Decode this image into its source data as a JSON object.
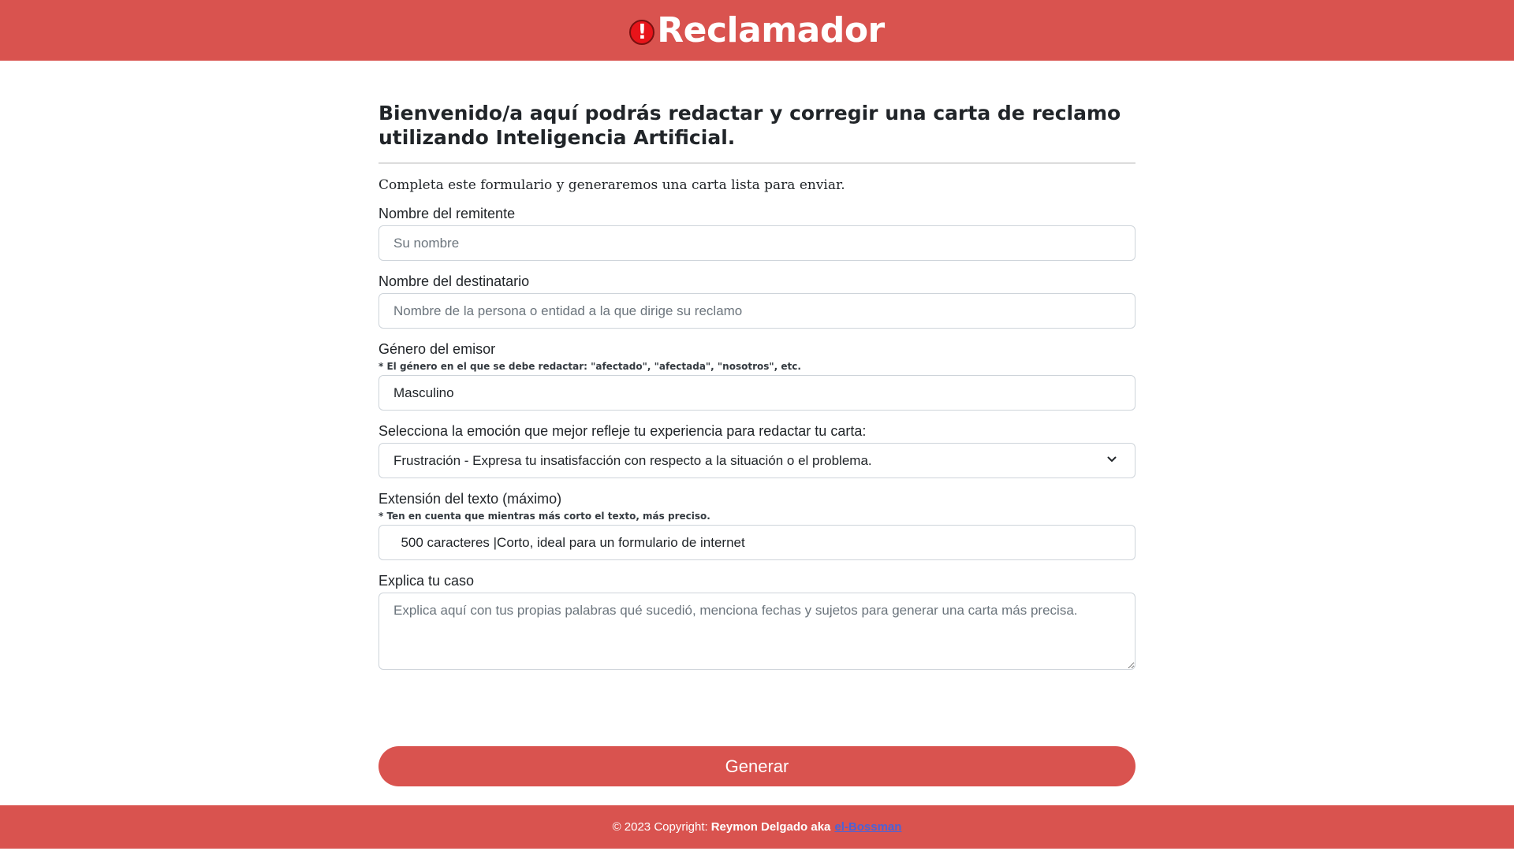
{
  "header": {
    "brand_icon": "!",
    "brand_name": "Reclamador"
  },
  "intro": {
    "title": "Bienvenido/a aquí podrás redactar y corregir una carta de reclamo utilizando Inteligencia Artificial.",
    "subtitle": "Completa este formulario y generaremos una carta lista para enviar."
  },
  "form": {
    "sender": {
      "label": "Nombre del remitente",
      "placeholder": "Su nombre"
    },
    "recipient": {
      "label": "Nombre del destinatario",
      "placeholder": "Nombre de la persona o entidad a la que dirige su reclamo"
    },
    "gender": {
      "label": "Género del emisor",
      "hint": "* El género en el que se debe redactar: \"afectado\", \"afectada\", \"nosotros\", etc.",
      "value": "Masculino"
    },
    "emotion": {
      "label": "Selecciona la emoción que mejor refleje tu experiencia para redactar tu carta:",
      "selected": "Frustración - Expresa tu insatisfacción con respecto a la situación o el problema."
    },
    "length": {
      "label": "Extensión del texto (máximo)",
      "hint": "* Ten en cuenta que mientras más corto el texto, más preciso.",
      "value": "  500 caracteres |Corto, ideal para un formulario de internet"
    },
    "case": {
      "label": "Explica tu caso",
      "placeholder": "Explica aquí con tus propias palabras qué sucedió, menciona fechas y sujetos para generar una carta más precisa."
    },
    "submit_label": "Generar"
  },
  "footer": {
    "copyright": "© 2023 Copyright:",
    "author": "Reymon Delgado aka",
    "alias": "el-Bossman"
  },
  "colors": {
    "brand": "#d9534f",
    "icon_red": "#e8141a",
    "link": "#4a63d8"
  }
}
